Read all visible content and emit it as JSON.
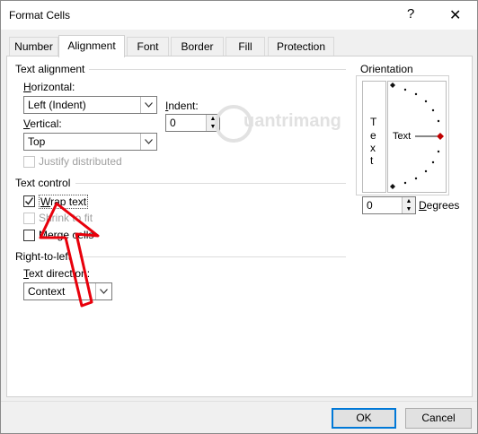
{
  "window": {
    "title": "Format Cells",
    "help_glyph": "?",
    "close_glyph": "✕"
  },
  "tabs": [
    "Number",
    "Alignment",
    "Font",
    "Border",
    "Fill",
    "Protection"
  ],
  "text_alignment": {
    "section_label": "Text alignment",
    "horizontal_label": "Horizontal:",
    "horizontal_value": "Left (Indent)",
    "indent_label": "Indent:",
    "indent_value": "0",
    "vertical_label": "Vertical:",
    "vertical_value": "Top",
    "justify_label": "Justify distributed"
  },
  "text_control": {
    "section_label": "Text control",
    "wrap_label": "Wrap text",
    "wrap_checked": true,
    "shrink_label": "Shrink to fit",
    "merge_label": "Merge cells"
  },
  "rtl": {
    "section_label": "Right-to-left",
    "direction_label": "Text direction:",
    "direction_value": "Context"
  },
  "orientation": {
    "section_label": "Orientation",
    "vertical_text": [
      "T",
      "e",
      "x",
      "t"
    ],
    "dial_text": "Text",
    "degrees_value": "0",
    "degrees_label": "Degrees"
  },
  "watermark": {
    "text": "uantrimang"
  },
  "buttons": {
    "ok": "OK",
    "cancel": "Cancel"
  },
  "colors": {
    "annotation_arrow": "#e8000b",
    "default_button_border": "#0078d7"
  }
}
